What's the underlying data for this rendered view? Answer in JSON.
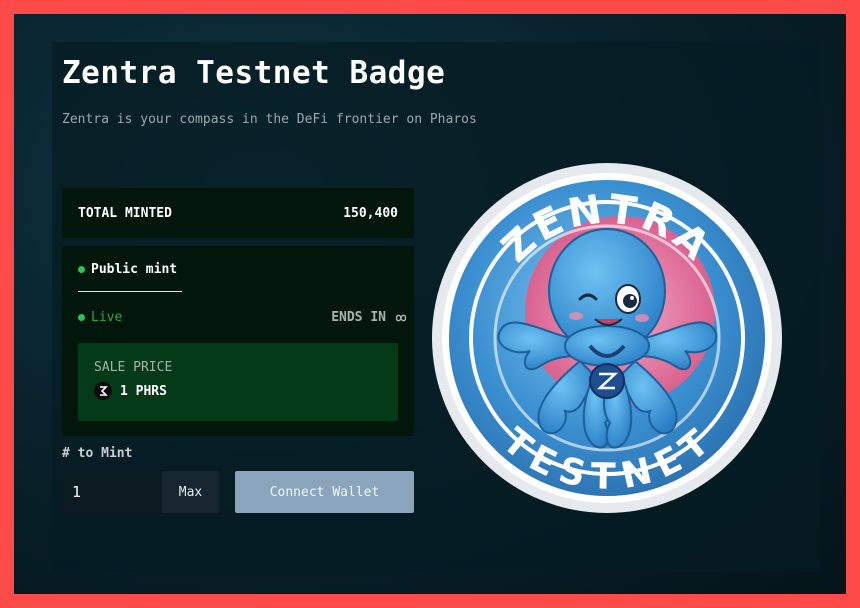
{
  "page": {
    "title": "Zentra Testnet Badge",
    "subtitle": "Zentra is your compass in the DeFi frontier on Pharos"
  },
  "stats": {
    "total_minted_label": "TOTAL MINTED",
    "total_minted_value": "150,400"
  },
  "mint_phase": {
    "tab_label": "Public mint",
    "status_label": "Live",
    "ends_in_label": "ENDS IN",
    "ends_in_icon": "infinity-icon",
    "sale_price_label": "SALE PRICE",
    "sale_price_value": "1 PHRS",
    "currency_icon": "pharos-token-icon"
  },
  "mint_form": {
    "quantity_label": "# to Mint",
    "quantity_value": "1",
    "max_label": "Max",
    "connect_label": "Connect Wallet"
  },
  "badge": {
    "top_text": "ZENTRA",
    "bottom_text": "TESTNET",
    "image": "octopus-mascot-badge"
  },
  "colors": {
    "accent_green": "#22c55e",
    "panel_bg": "#03160c",
    "price_bg": "#053a19",
    "connect_button": "#8aa4bb",
    "frame_border": "#ff4a4a"
  }
}
